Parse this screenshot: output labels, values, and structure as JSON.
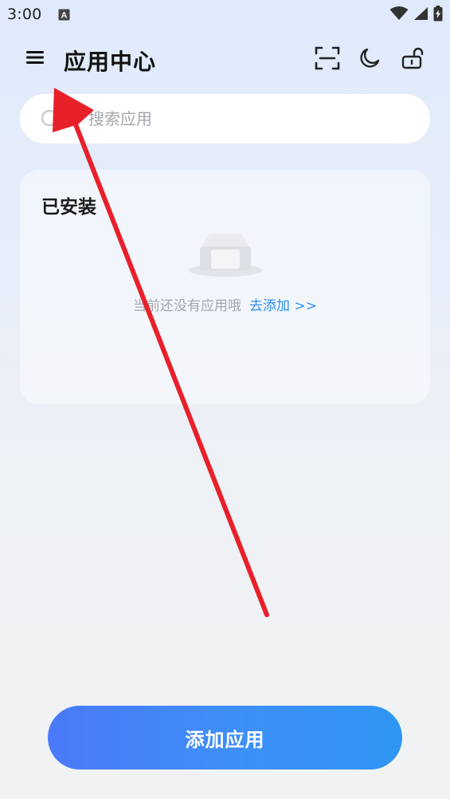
{
  "status_bar": {
    "time": "3:00",
    "notification_icon": "a-letter-icon",
    "wifi_icon": "wifi-icon",
    "signal_icon": "signal-icon",
    "battery_icon": "battery-charging-icon"
  },
  "app_bar": {
    "menu_icon": "hamburger-menu-icon",
    "title": "应用中心",
    "actions": [
      {
        "icon": "scan-icon"
      },
      {
        "icon": "moon-icon"
      },
      {
        "icon": "unlock-icon"
      }
    ]
  },
  "search": {
    "placeholder": "搜索应用",
    "value": ""
  },
  "installed": {
    "title": "已安装",
    "empty_icon": "empty-tray-icon",
    "empty_text": "当前还没有应用哦",
    "add_link": "去添加 >>"
  },
  "footer": {
    "add_button": "添加应用"
  },
  "colors": {
    "accent": "#2f8ff0",
    "button_start": "#4a79f9",
    "button_end": "#2f96f3",
    "annotation_arrow": "#e8202a"
  }
}
